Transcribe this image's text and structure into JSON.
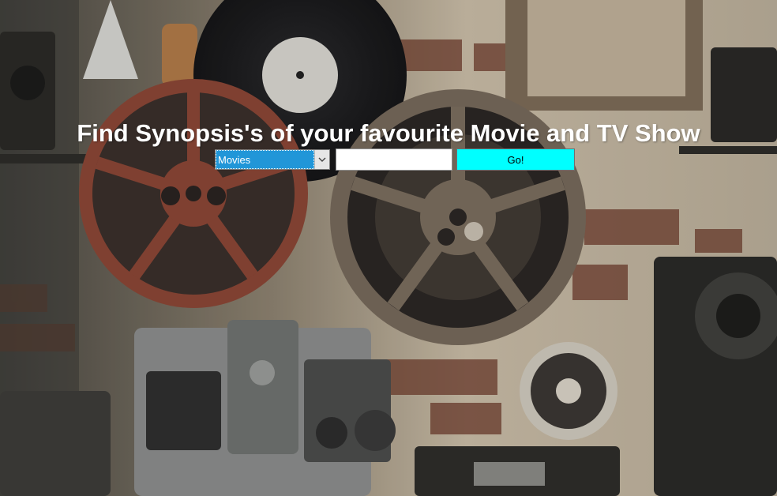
{
  "header": {
    "title": "Find Synopsis's of your favourite Movie and TV Show"
  },
  "search": {
    "category_selected": "Movies",
    "category_icon": "chevron-down-icon",
    "input_value": "",
    "input_placeholder": "",
    "submit_label": "Go!"
  },
  "colors": {
    "select_highlight": "#2196d8",
    "button_background": "#00ffff",
    "headline_text": "#ffffff"
  }
}
